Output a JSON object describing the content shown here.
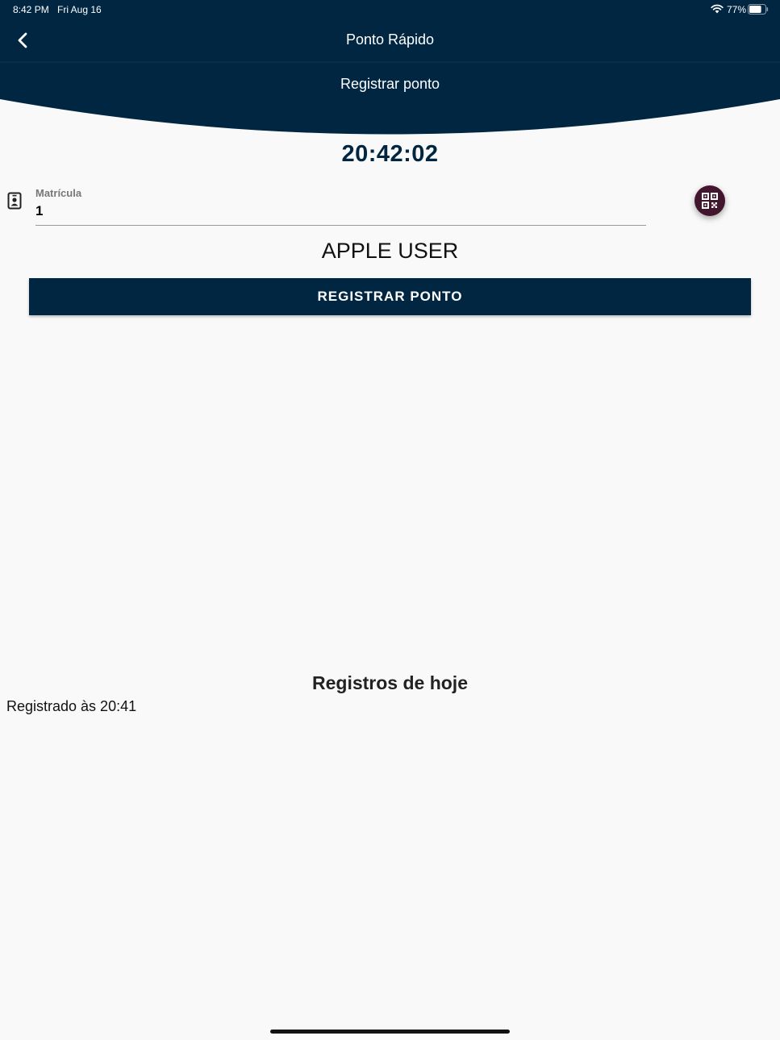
{
  "status_bar": {
    "time": "8:42 PM",
    "date": "Fri Aug 16",
    "battery": "77%",
    "battery_level": 0.77
  },
  "nav": {
    "title": "Ponto Rápido",
    "back_icon": "chevron-left-icon"
  },
  "banner": {
    "title": "Registrar ponto"
  },
  "clock": "20:42:02",
  "form": {
    "matricula_label": "Matrícula",
    "matricula_value": "1",
    "qr_icon": "qr-code-icon"
  },
  "user_name": "APPLE USER",
  "register_button_label": "REGISTRAR PONTO",
  "records": {
    "heading": "Registros de hoje",
    "items": [
      "Registrado às 20:41"
    ]
  },
  "colors": {
    "primary": "#002642",
    "qr_button": "#42172d",
    "background": "#f9f9f9"
  }
}
